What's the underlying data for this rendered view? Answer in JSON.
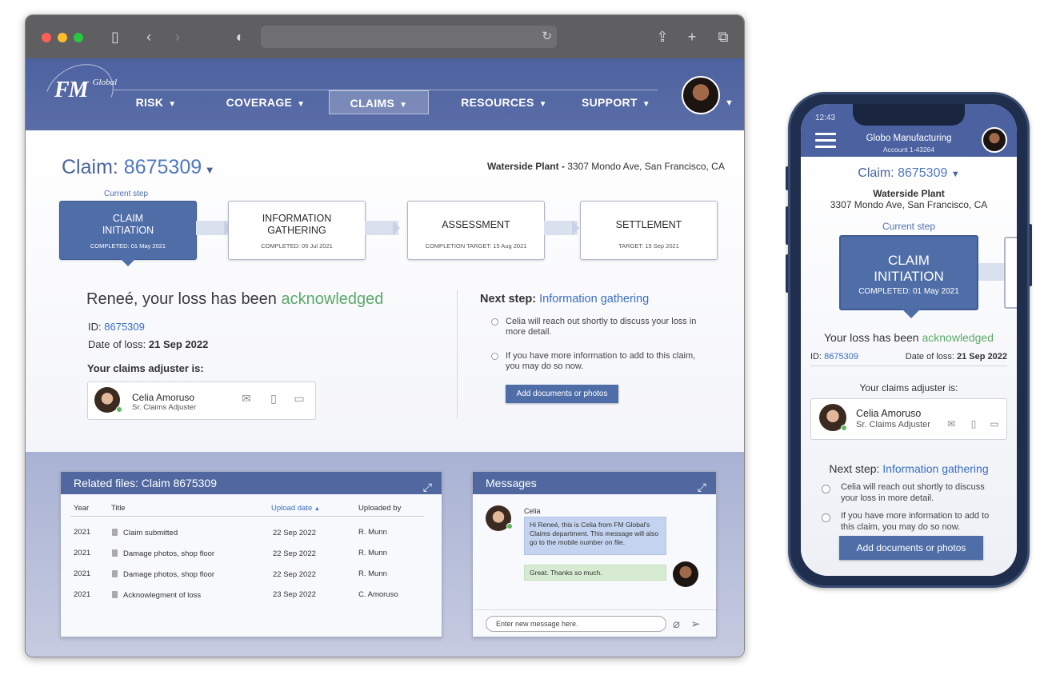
{
  "colors": {
    "brand_blue": "#4f6ea8",
    "header_blue": "#4d62a0",
    "accent_green": "#5ca869",
    "link_blue": "#3a6ec0"
  },
  "browser": {
    "toolbar_icons": [
      "sidebar-icon",
      "back-icon",
      "forward-icon",
      "shield-icon",
      "reload-icon",
      "share-icon",
      "new-tab-icon",
      "tabs-icon"
    ]
  },
  "header": {
    "logo": "FM Global",
    "nav": [
      {
        "label": "RISK",
        "active": false
      },
      {
        "label": "COVERAGE",
        "active": false
      },
      {
        "label": "CLAIMS",
        "active": true
      },
      {
        "label": "RESOURCES",
        "active": false
      },
      {
        "label": "SUPPORT",
        "active": false
      }
    ]
  },
  "claim": {
    "label": "Claim:",
    "number": "8675309",
    "plant_name": "Waterside Plant -",
    "plant_address": "3307 Mondo Ave, San Francisco, CA",
    "current_step_label": "Current step",
    "steps": [
      {
        "title": "CLAIM INITIATION",
        "sub": "COMPLETED: 01 May 2021"
      },
      {
        "title": "INFORMATION GATHERING",
        "sub": "COMPLETED: 05 Jul 2021"
      },
      {
        "title": "ASSESSMENT",
        "sub": "COMPLETION TARGET: 15 Aug 2021"
      },
      {
        "title": "SETTLEMENT",
        "sub": "TARGET: 15 Sep 2021"
      }
    ]
  },
  "acknowledgment": {
    "title_prefix": "Reneé, your loss has been",
    "title_highlight": "acknowledged",
    "id_label": "ID:",
    "id_value": "8675309",
    "date_label": "Date of loss:",
    "date_value": "21 Sep 2022",
    "adjuster_label": "Your claims adjuster is:",
    "adjuster_name": "Celia Amoruso",
    "adjuster_role": "Sr. Claims Adjuster"
  },
  "next_step": {
    "label": "Next step:",
    "value": "Information gathering",
    "bullets": [
      "Celia will reach out shortly to discuss your loss in more detail.",
      "If you have more information to add to this claim, you may do so now."
    ],
    "button": "Add documents or photos"
  },
  "files": {
    "title": "Related files: Claim 8675309",
    "columns": [
      "Year",
      "Title",
      "Upload date",
      "Uploaded by"
    ],
    "sort_indicator": "▲",
    "rows": [
      {
        "year": "2021",
        "title": "Claim submitted",
        "date": "22 Sep 2022",
        "by": "R. Munn"
      },
      {
        "year": "2021",
        "title": "Damage photos, shop floor",
        "date": "22 Sep 2022",
        "by": "R. Munn"
      },
      {
        "year": "2021",
        "title": "Damage photos, shop floor",
        "date": "22 Sep 2022",
        "by": "R. Munn"
      },
      {
        "year": "2021",
        "title": "Acknowlegment of loss",
        "date": "23 Sep 2022",
        "by": "C. Amoruso"
      }
    ]
  },
  "messages": {
    "title": "Messages",
    "from": "Celia",
    "incoming": "Hi Reneé, this is Celia from FM Global's Claims department. This message will also go to the mobile number on file.",
    "outgoing": "Great. Thanks so much.",
    "input_placeholder": "Enter new message here."
  },
  "phone": {
    "time": "12:43",
    "company": "Globo Manufacturing",
    "account": "Account 1-43264",
    "claim_label": "Claim:",
    "claim_number": "8675309",
    "plant_name": "Waterside Plant",
    "plant_address": "3307 Mondo Ave, San Francisco, CA",
    "current_step_label": "Current step",
    "step_title": "CLAIM INITIATION",
    "step_sub": "COMPLETED: 01 May 2021",
    "ack_prefix": "Your loss has been",
    "ack_highlight": "acknowledged",
    "id_label": "ID:",
    "id_value": "8675309",
    "date_label": "Date of loss:",
    "date_value": "21 Sep 2022",
    "adjuster_label": "Your claims adjuster is:",
    "adjuster_name": "Celia Amoruso",
    "adjuster_role": "Sr. Claims Adjuster",
    "next_label": "Next step:",
    "next_value": "Information gathering",
    "bullets": [
      "Celia will reach out shortly to discuss your loss in more detail.",
      "If you have more information to add to this claim, you may do so now."
    ],
    "button": "Add documents or photos"
  }
}
